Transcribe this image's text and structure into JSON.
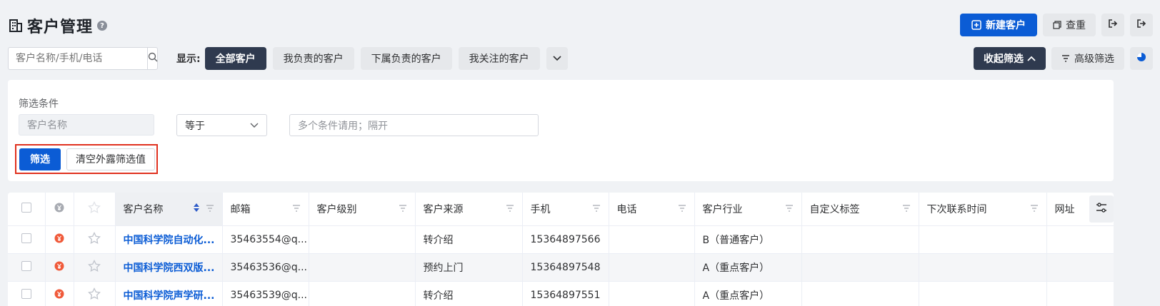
{
  "header": {
    "title": "客户管理",
    "help_icon": "?"
  },
  "top_actions": {
    "new_customer": "新建客户",
    "dedupe": "查重"
  },
  "search": {
    "placeholder": "客户名称/手机/电话"
  },
  "views": {
    "label": "显示:",
    "tabs": [
      "全部客户",
      "我负责的客户",
      "下属负责的客户",
      "我关注的客户"
    ]
  },
  "filters": {
    "collapse": "收起筛选",
    "advanced": "高级筛选"
  },
  "condition_panel": {
    "title": "筛选条件",
    "field": "客户名称",
    "operator": "等于",
    "value_placeholder": "多个条件请用；隔开",
    "filter_button": "筛选",
    "clear_button": "清空外露筛选值"
  },
  "table": {
    "columns": [
      "客户名称",
      "邮箱",
      "客户级别",
      "客户来源",
      "手机",
      "电话",
      "客户行业",
      "自定义标签",
      "下次联系时间",
      "网址"
    ],
    "rows": [
      {
        "name": "中国科学院自动化...",
        "email": "35463554@q...",
        "level": "",
        "source": "转介绍",
        "mobile": "15364897566",
        "phone": "",
        "industry": "B（普通客户）",
        "tags": "",
        "next_contact": "",
        "site": ""
      },
      {
        "name": "中国科学院西双版...",
        "email": "35463536@q...",
        "level": "",
        "source": "预约上门",
        "mobile": "15364897548",
        "phone": "",
        "industry": "A（重点客户）",
        "tags": "",
        "next_contact": "",
        "site": ""
      },
      {
        "name": "中国科学院声学研...",
        "email": "35463539@q...",
        "level": "",
        "source": "转介绍",
        "mobile": "15364897551",
        "phone": "",
        "industry": "A（重点客户）",
        "tags": "",
        "next_contact": "",
        "site": ""
      }
    ]
  },
  "colors": {
    "primary": "#0b5cd5",
    "dark": "#2f3a4f",
    "highlight_border": "#e0311f",
    "money_icon": "#f05a3a"
  }
}
